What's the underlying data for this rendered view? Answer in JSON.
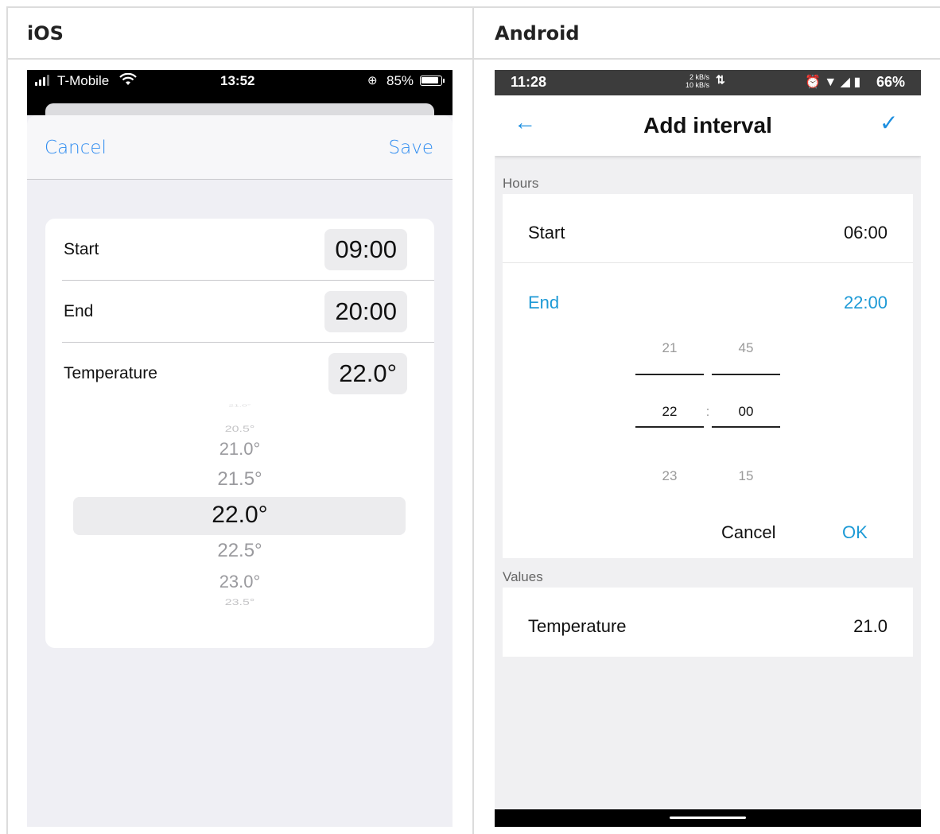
{
  "headers": {
    "ios": "iOS",
    "android": "Android"
  },
  "ios": {
    "status": {
      "carrier": "T-Mobile",
      "time": "13:52",
      "battery": "85%"
    },
    "nav": {
      "cancel": "Cancel",
      "save": "Save"
    },
    "rows": [
      {
        "label": "Start",
        "value": "09:00"
      },
      {
        "label": "End",
        "value": "20:00"
      },
      {
        "label": "Temperature",
        "value": "22.0°"
      }
    ],
    "picker": {
      "items": [
        "20.5°",
        "21.0°",
        "21.5°",
        "22.0°",
        "22.5°",
        "23.0°",
        "23.5°"
      ],
      "selected": "22.0°"
    }
  },
  "android": {
    "status": {
      "time": "11:28",
      "speed_up": "2 kB/s",
      "speed_down": "10 kB/s",
      "battery": "66%"
    },
    "title": "Add interval",
    "hours_section": "Hours",
    "start": {
      "label": "Start",
      "value": "06:00"
    },
    "end": {
      "label": "End",
      "value": "22:00"
    },
    "time_picker": {
      "hours": {
        "prev": "21",
        "current": "22",
        "next": "23"
      },
      "minutes": {
        "prev": "45",
        "current": "00",
        "next": "15"
      },
      "separator": ":"
    },
    "dialog": {
      "cancel": "Cancel",
      "ok": "OK"
    },
    "values_section": "Values",
    "temperature": {
      "label": "Temperature",
      "value": "21.0"
    },
    "colors": {
      "accent": "#1d9ad6",
      "ios_accent": "#2f8cf0"
    }
  }
}
